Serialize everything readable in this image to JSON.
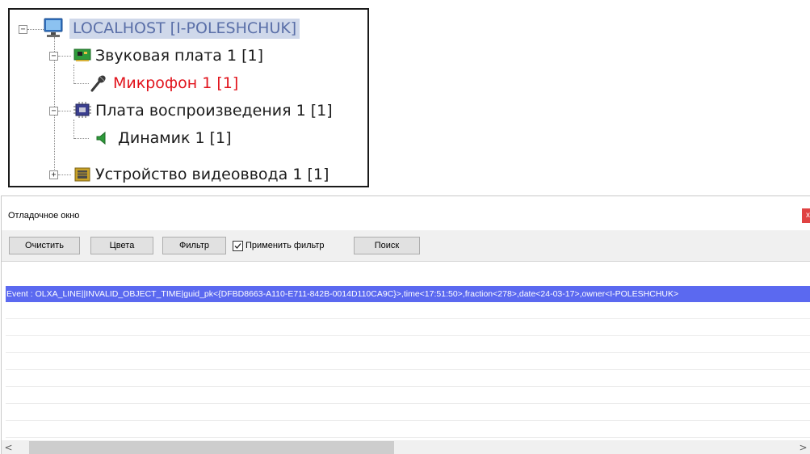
{
  "tree": {
    "root": {
      "label": "LOCALHOST [I-POLESHCHUK]"
    },
    "sound_card": {
      "label": "Звуковая плата 1 [1]"
    },
    "microphone": {
      "label": "Микрофон 1 [1]"
    },
    "playback_card": {
      "label": "Плата воспроизведения 1 [1]"
    },
    "speaker": {
      "label": "Динамик 1 [1]"
    },
    "video_input": {
      "label": "Устройство видеоввода 1 [1]"
    },
    "toggles": {
      "expanded": "−",
      "collapsed": "+"
    },
    "icons": [
      "computer-icon",
      "sound-card-icon",
      "microphone-icon",
      "playback-card-icon",
      "speaker-icon",
      "video-input-icon"
    ]
  },
  "debug_window": {
    "title": "Отладочное окно",
    "close_label": "x",
    "toolbar": {
      "clear": "Очистить",
      "colors": "Цвета",
      "filter": "Фильтр",
      "apply_filter": "Применить фильтр",
      "apply_filter_checked": true,
      "search": "Поиск"
    },
    "log": {
      "lines": [
        "Event : OLXA_LINE||INVALID_OBJECT_TIME|guid_pk<{DFBD8663-A110-E711-842B-0014D110CA9C}>,time<17:51:50>,fraction<278>,date<24-03-17>,owner<I-POLESHCHUK>"
      ]
    },
    "scrollbar": {
      "left_arrow": "<",
      "right_arrow": ">"
    }
  },
  "colors": {
    "selection": "#5b69f0",
    "tree_selected_bg": "#cfd8ea",
    "tree_selected_text": "#5a6fa8",
    "microphone_text": "#e1131c",
    "close_button": "#e04343"
  }
}
